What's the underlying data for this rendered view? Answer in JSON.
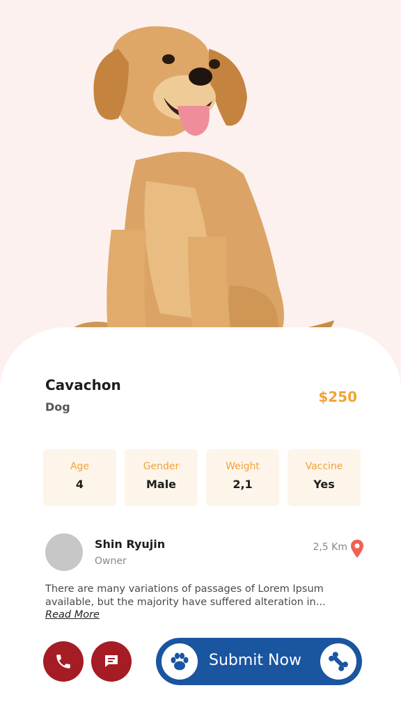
{
  "pet": {
    "name": "Cavachon",
    "type": "Dog",
    "price": "$250"
  },
  "stats": [
    {
      "label": "Age",
      "value": "4"
    },
    {
      "label": "Gender",
      "value": "Male"
    },
    {
      "label": "Weight",
      "value": "2,1"
    },
    {
      "label": "Vaccine",
      "value": "Yes"
    }
  ],
  "owner": {
    "name": "Shin Ryujin",
    "role": "Owner",
    "distance": "2,5 Km"
  },
  "description": {
    "text": "There are many variations of passages of Lorem Ipsum available, but the majority have suffered alteration in...",
    "read_more": "Read More"
  },
  "actions": {
    "submit_label": "Submit Now"
  },
  "icons": {
    "call": "phone-icon",
    "chat": "chat-icon",
    "paw": "paw-icon",
    "bone": "bone-icon",
    "location": "location-pin-icon"
  },
  "colors": {
    "accent": "#f2a33a",
    "hero_bg": "#fdf1f0",
    "stat_bg": "#fdf5ea",
    "action_red": "#a51c24",
    "submit_blue": "#1a55a0",
    "pin": "#f0614f"
  }
}
